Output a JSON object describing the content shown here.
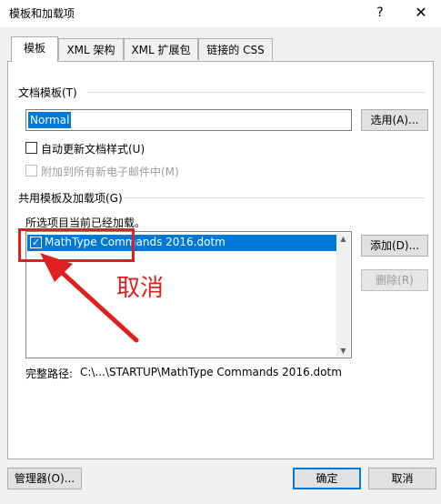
{
  "window": {
    "title": "模板和加载项",
    "help_glyph": "?",
    "close_glyph": "✕"
  },
  "tabs": [
    {
      "label": "模板",
      "active": true
    },
    {
      "label": "XML 架构",
      "active": false
    },
    {
      "label": "XML 扩展包",
      "active": false
    },
    {
      "label": "链接的 CSS",
      "active": false
    }
  ],
  "doc_template": {
    "group_label": "文档模板(T)",
    "value": "Normal",
    "select_button": "选用(A)...",
    "auto_update_label": "自动更新文档样式(U)",
    "auto_update_checked": false,
    "attach_email_label": "附加到所有新电子邮件中(M)",
    "attach_email_checked": false,
    "attach_email_enabled": false
  },
  "global_templates": {
    "group_label": "共用模板及加载项(G)",
    "loaded_note": "所选项目当前已经加载。",
    "items": [
      {
        "label": "MathType Commands 2016.dotm",
        "checked": true,
        "selected": true
      }
    ],
    "add_button": "添加(D)...",
    "remove_button": "删除(R)",
    "full_path_label": "完整路径:",
    "full_path_value": "C:\\...\\STARTUP\\MathType Commands 2016.dotm"
  },
  "annotation": {
    "text": "取消",
    "color": "#e02020"
  },
  "footer": {
    "organizer_button": "管理器(O)...",
    "ok_button": "确定",
    "cancel_button": "取消"
  },
  "colors": {
    "accent": "#0078d7",
    "annotation_red": "#e02020"
  },
  "icons": {
    "checkmark": "✓",
    "scroll_up": "▲",
    "scroll_down": "▼"
  }
}
